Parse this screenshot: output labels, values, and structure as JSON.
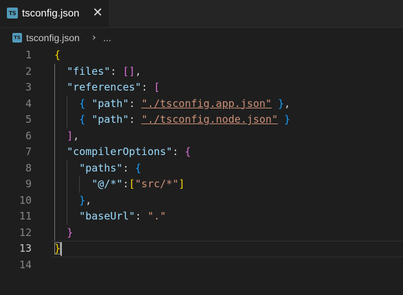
{
  "tab": {
    "icon_label": "TS",
    "title": "tsconfig.json",
    "close_glyph": "✕"
  },
  "breadcrumb": {
    "icon_label": "TS",
    "file": "tsconfig.json",
    "separator": "›",
    "more": "..."
  },
  "editor": {
    "current_line": 13,
    "line_numbers": [
      "1",
      "2",
      "3",
      "4",
      "5",
      "6",
      "7",
      "8",
      "9",
      "10",
      "11",
      "12",
      "13",
      "14"
    ],
    "lines": [
      [
        {
          "t": "{",
          "c": "b1"
        }
      ],
      [
        {
          "t": "  "
        },
        {
          "t": "\"files\"",
          "c": "k"
        },
        {
          "t": ": ",
          "c": "p"
        },
        {
          "t": "[]",
          "c": "b2"
        },
        {
          "t": ",",
          "c": "p"
        }
      ],
      [
        {
          "t": "  "
        },
        {
          "t": "\"references\"",
          "c": "k"
        },
        {
          "t": ": ",
          "c": "p"
        },
        {
          "t": "[",
          "c": "b2"
        }
      ],
      [
        {
          "t": "    "
        },
        {
          "t": "{",
          "c": "b3"
        },
        {
          "t": " ",
          "c": "p"
        },
        {
          "t": "\"path\"",
          "c": "k"
        },
        {
          "t": ": ",
          "c": "p"
        },
        {
          "t": "\"./tsconfig.app.json\"",
          "c": "s u"
        },
        {
          "t": " ",
          "c": "p"
        },
        {
          "t": "}",
          "c": "b3"
        },
        {
          "t": ",",
          "c": "p"
        }
      ],
      [
        {
          "t": "    "
        },
        {
          "t": "{",
          "c": "b3"
        },
        {
          "t": " ",
          "c": "p"
        },
        {
          "t": "\"path\"",
          "c": "k"
        },
        {
          "t": ": ",
          "c": "p"
        },
        {
          "t": "\"./tsconfig.node.json\"",
          "c": "s u"
        },
        {
          "t": " ",
          "c": "p"
        },
        {
          "t": "}",
          "c": "b3"
        }
      ],
      [
        {
          "t": "  "
        },
        {
          "t": "]",
          "c": "b2"
        },
        {
          "t": ",",
          "c": "p"
        }
      ],
      [
        {
          "t": "  "
        },
        {
          "t": "\"compilerOptions\"",
          "c": "k"
        },
        {
          "t": ": ",
          "c": "p"
        },
        {
          "t": "{",
          "c": "b2"
        }
      ],
      [
        {
          "t": "    "
        },
        {
          "t": "\"paths\"",
          "c": "k"
        },
        {
          "t": ": ",
          "c": "p"
        },
        {
          "t": "{",
          "c": "b3"
        }
      ],
      [
        {
          "t": "      "
        },
        {
          "t": "\"@/*\"",
          "c": "k"
        },
        {
          "t": ":",
          "c": "p"
        },
        {
          "t": "[",
          "c": "b1"
        },
        {
          "t": "\"src/*\"",
          "c": "s"
        },
        {
          "t": "]",
          "c": "b1"
        }
      ],
      [
        {
          "t": "    "
        },
        {
          "t": "}",
          "c": "b3"
        },
        {
          "t": ",",
          "c": "p"
        }
      ],
      [
        {
          "t": "    "
        },
        {
          "t": "\"baseUrl\"",
          "c": "k"
        },
        {
          "t": ": ",
          "c": "p"
        },
        {
          "t": "\".\"",
          "c": "s"
        }
      ],
      [
        {
          "t": "  "
        },
        {
          "t": "}",
          "c": "b2"
        }
      ],
      [
        {
          "t": "}",
          "c": "b1 bm"
        }
      ],
      []
    ]
  }
}
